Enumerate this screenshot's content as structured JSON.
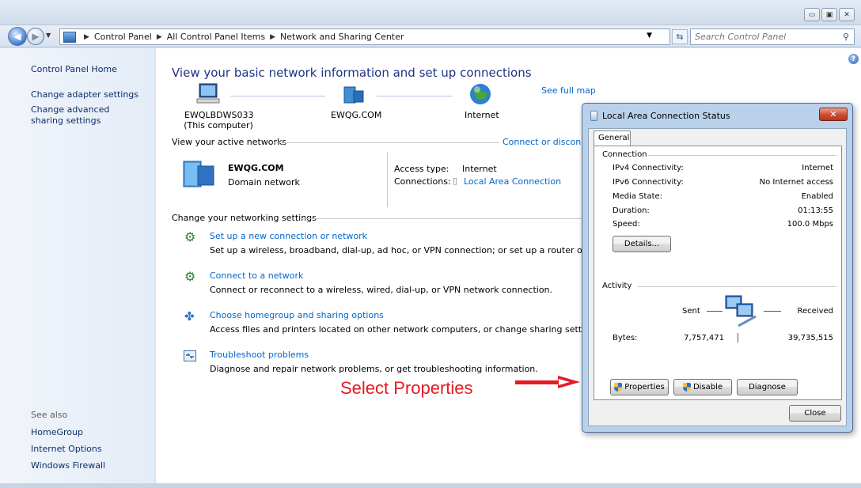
{
  "window": {
    "controls": {
      "minimize": "▭",
      "maximize": "▣",
      "close": "✕"
    }
  },
  "address_bar": {
    "crumbs": [
      "Control Panel",
      "All Control Panel Items",
      "Network and Sharing Center"
    ],
    "search_placeholder": "Search Control Panel"
  },
  "left_pane": {
    "home": "Control Panel Home",
    "links": [
      "Change adapter settings",
      "Change advanced sharing settings"
    ],
    "see_also_label": "See also",
    "see_also": [
      "HomeGroup",
      "Internet Options",
      "Windows Firewall"
    ]
  },
  "main": {
    "heading": "View your basic network information and set up connections",
    "see_full_map": "See full map",
    "map": {
      "computer_name": "EWQLBDWS033",
      "computer_sub": "(This computer)",
      "domain": "EWQG.COM",
      "internet": "Internet"
    },
    "active_networks_label": "View your active networks",
    "connect_disconnect": "Connect or disconne",
    "network": {
      "name": "EWQG.COM",
      "type": "Domain network",
      "access_type_label": "Access type:",
      "access_type_value": "Internet",
      "connections_label": "Connections:",
      "connections_value": "Local Area Connection"
    },
    "change_settings_label": "Change your networking settings",
    "tasks": [
      {
        "title": "Set up a new connection or network",
        "desc": "Set up a wireless, broadband, dial-up, ad hoc, or VPN connection; or set up a router or access poi"
      },
      {
        "title": "Connect to a network",
        "desc": "Connect or reconnect to a wireless, wired, dial-up, or VPN network connection."
      },
      {
        "title": "Choose homegroup and sharing options",
        "desc": "Access files and printers located on other network computers, or change sharing settings."
      },
      {
        "title": "Troubleshoot problems",
        "desc": "Diagnose and repair network problems, or get troubleshooting information."
      }
    ]
  },
  "dialog": {
    "title": "Local Area Connection Status",
    "tab": "General",
    "connection_label": "Connection",
    "rows": [
      {
        "label": "IPv4 Connectivity:",
        "value": "Internet"
      },
      {
        "label": "IPv6 Connectivity:",
        "value": "No Internet access"
      },
      {
        "label": "Media State:",
        "value": "Enabled"
      },
      {
        "label": "Duration:",
        "value": "01:13:55"
      },
      {
        "label": "Speed:",
        "value": "100.0 Mbps"
      }
    ],
    "details_button": "Details...",
    "activity_label": "Activity",
    "sent_label": "Sent",
    "received_label": "Received",
    "bytes_label": "Bytes:",
    "bytes_sent": "7,757,471",
    "bytes_received": "39,735,515",
    "properties_button": "Properties",
    "disable_button": "Disable",
    "diagnose_button": "Diagnose",
    "close_button": "Close"
  },
  "annotation": {
    "text": "Select Properties",
    "color": "#e31b23"
  }
}
